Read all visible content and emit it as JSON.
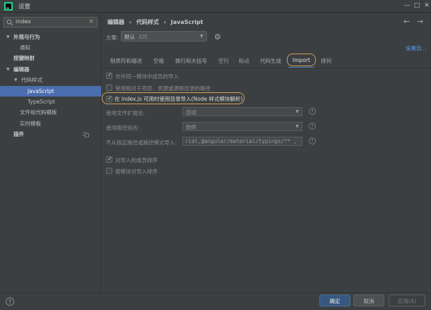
{
  "window": {
    "title": "设置",
    "controls": {
      "minimize": "—",
      "maximize": "□",
      "close": "✕"
    }
  },
  "sidebar": {
    "search": {
      "value": "index",
      "icon": "search-icon"
    },
    "tree": [
      {
        "label": "外观与行为",
        "level": 0,
        "bold": true,
        "expanded": true
      },
      {
        "label": "通知",
        "level": 1
      },
      {
        "label": "按键映射",
        "level": 0,
        "bold": true
      },
      {
        "label": "编辑器",
        "level": 0,
        "bold": true,
        "expanded": true
      },
      {
        "label": "代码样式",
        "level": 1,
        "expanded": true
      },
      {
        "label": "JavaScript",
        "level": 2,
        "selected": true
      },
      {
        "label": "TypeScript",
        "level": 2
      },
      {
        "label": "文件和代码模板",
        "level": 1
      },
      {
        "label": "实时模板",
        "level": 1
      },
      {
        "label": "插件",
        "level": 0,
        "bold": true
      }
    ]
  },
  "header": {
    "breadcrumb": [
      "编辑器",
      "›",
      "代码样式",
      "›",
      "JavaScript"
    ],
    "back": "←",
    "forward": "→"
  },
  "scheme": {
    "label": "方案:",
    "value_main": "默认",
    "value_sub": "IDE",
    "set_from": "设置自..."
  },
  "tabs": [
    {
      "label": "制表符和缩进"
    },
    {
      "label": "空格"
    },
    {
      "label": "换行和大括号"
    },
    {
      "label": "空行"
    },
    {
      "label": "标点"
    },
    {
      "label": "代码生成"
    },
    {
      "label": "Import",
      "active": true
    },
    {
      "label": "排列"
    }
  ],
  "options": {
    "merge_imports": {
      "label": "合并同一模块中成员的导入",
      "checked": true,
      "enabled": false
    },
    "use_relative_paths": {
      "label": "使用相对于项目、资源或源根目录的路径",
      "checked": false,
      "enabled": false
    },
    "use_directory_imports": {
      "label": "在 index.js 可用时使用目录导入(Node 样式模块解析)",
      "checked": true,
      "enabled": true
    },
    "file_extension": {
      "label": "使用文件扩展名:",
      "value": "自动"
    },
    "path_alias": {
      "label": "使用路径别名:",
      "value": "始终"
    },
    "no_relative_from": {
      "label": "不从指定路径或路径模式导入:",
      "value": "rial,@angular/material/typings/** ,"
    },
    "sort_imported_members": {
      "label": "对导入的成员排序",
      "checked": true,
      "enabled": false
    },
    "sort_by_module": {
      "label": "按模块对导入排序",
      "checked": false,
      "enabled": false
    }
  },
  "buttons": {
    "ok": "确定",
    "cancel": "取消",
    "apply": "应用(A)",
    "help": "?"
  },
  "colors": {
    "background": "#3c3f41",
    "selection": "#4b6eaf",
    "highlight": "#d2a15a",
    "link": "#589df6",
    "primary_button": "#365880"
  }
}
